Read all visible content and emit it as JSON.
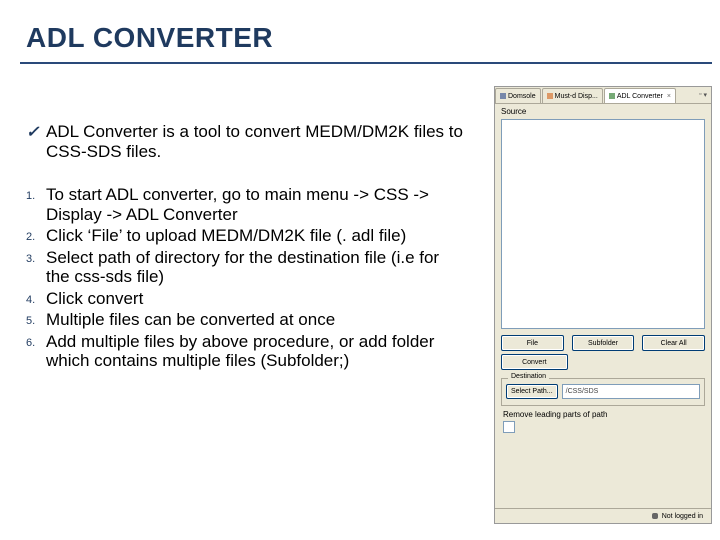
{
  "title": "ADL CONVERTER",
  "bullet": {
    "mark": "✓",
    "text": "ADL Converter is a tool to convert MEDM/DM2K files to CSS-SDS files."
  },
  "steps": [
    "To start ADL converter, go to main menu -> CSS -> Display -> ADL Converter",
    "Click ‘File’ to upload MEDM/DM2K file (. adl file)",
    "Select path of directory for the destination file (i.e for the css-sds file)",
    "Click convert",
    "Multiple files can be converted at once",
    "Add multiple files by above procedure, or add folder which contains multiple files (Subfolder;)"
  ],
  "screenshot": {
    "tabs": [
      {
        "label": "Domsole"
      },
      {
        "label": "Must-d Disp..."
      },
      {
        "label": "ADL Converter",
        "active": true
      }
    ],
    "tab_close": "×",
    "tab_menu": "▾",
    "source_label": "Source",
    "buttons_row1": [
      "File",
      "Subfolder",
      "Clear All"
    ],
    "buttons_row2": [
      "Convert"
    ],
    "destination": {
      "legend": "Destination",
      "select_path_label": "Select Path...",
      "path_value": "/CSS/SDS"
    },
    "checkbox": {
      "label": "Remove leading parts of path",
      "checked": false
    },
    "status": "Not logged in"
  }
}
